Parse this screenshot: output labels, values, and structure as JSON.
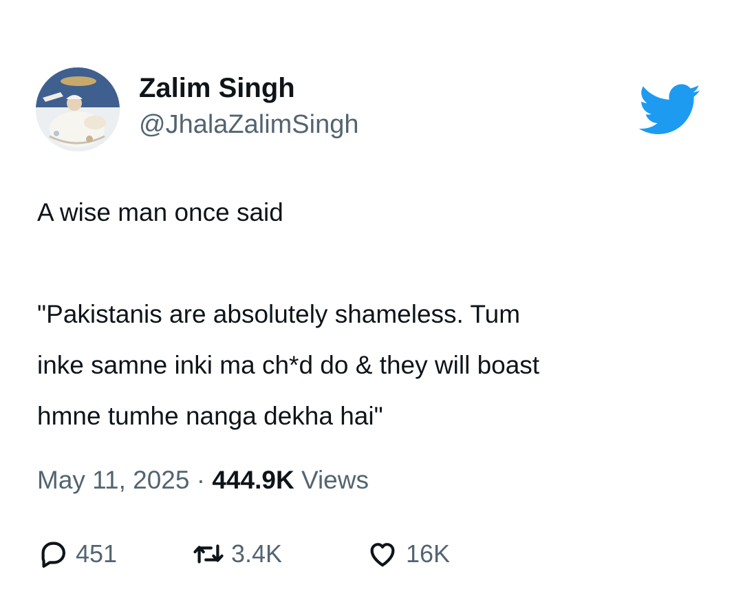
{
  "author": {
    "display_name": "Zalim Singh",
    "handle": "@JhalaZalimSingh",
    "avatar_icon": "avatar-painting-image"
  },
  "platform": {
    "logo_icon": "twitter-bird-icon",
    "logo_color": "#1d9bf0"
  },
  "tweet": {
    "lines": [
      "A wise man once said",
      "",
      "\"Pakistanis are absolutely shameless. Tum",
      "inke samne inki ma ch*d do & they will boast",
      "hmne tumhe nanga dekha hai\""
    ]
  },
  "meta": {
    "date": "May 11, 2025",
    "separator": "·",
    "views_count": "444.9K",
    "views_label": "Views"
  },
  "actions": {
    "reply": {
      "icon": "reply-bubble-icon",
      "count": "451"
    },
    "retweet": {
      "icon": "retweet-icon",
      "count": "3.4K"
    },
    "like": {
      "icon": "heart-icon",
      "count": "16K"
    }
  },
  "colors": {
    "text_primary": "#0f1419",
    "text_secondary": "#536471",
    "background": "#ffffff"
  }
}
